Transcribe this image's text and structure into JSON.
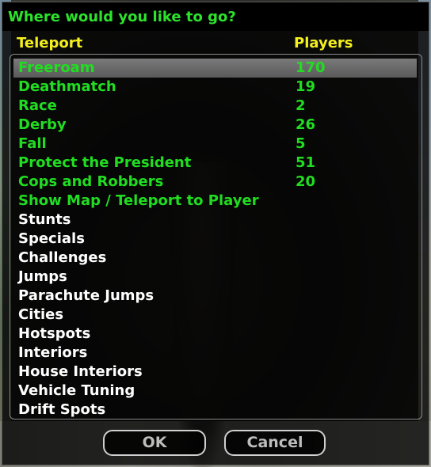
{
  "dialog": {
    "title": "Where would you like to go?",
    "headers": {
      "teleport": "Teleport",
      "players": "Players"
    },
    "rows": [
      {
        "name": "Freeroam",
        "players": "170",
        "color": "#21dd21",
        "selected": true
      },
      {
        "name": "Deathmatch",
        "players": "19",
        "color": "#21dd21",
        "selected": false
      },
      {
        "name": "Race",
        "players": "2",
        "color": "#21dd21",
        "selected": false
      },
      {
        "name": "Derby",
        "players": "26",
        "color": "#21dd21",
        "selected": false
      },
      {
        "name": "Fall",
        "players": "5",
        "color": "#21dd21",
        "selected": false
      },
      {
        "name": "Protect the President",
        "players": "51",
        "color": "#21dd21",
        "selected": false
      },
      {
        "name": "Cops and Robbers",
        "players": "20",
        "color": "#21dd21",
        "selected": false
      },
      {
        "name": "Show Map / Teleport to Player",
        "players": "",
        "color": "#21dd21",
        "selected": false
      },
      {
        "name": "Stunts",
        "players": "",
        "color": "#ffffff",
        "selected": false
      },
      {
        "name": "Specials",
        "players": "",
        "color": "#ffffff",
        "selected": false
      },
      {
        "name": "Challenges",
        "players": "",
        "color": "#ffffff",
        "selected": false
      },
      {
        "name": "Jumps",
        "players": "",
        "color": "#ffffff",
        "selected": false
      },
      {
        "name": "Parachute Jumps",
        "players": "",
        "color": "#ffffff",
        "selected": false
      },
      {
        "name": "Cities",
        "players": "",
        "color": "#ffffff",
        "selected": false
      },
      {
        "name": "Hotspots",
        "players": "",
        "color": "#ffffff",
        "selected": false
      },
      {
        "name": "Interiors",
        "players": "",
        "color": "#ffffff",
        "selected": false
      },
      {
        "name": "House Interiors",
        "players": "",
        "color": "#ffffff",
        "selected": false
      },
      {
        "name": "Vehicle Tuning",
        "players": "",
        "color": "#ffffff",
        "selected": false
      },
      {
        "name": "Drift Spots",
        "players": "",
        "color": "#ffffff",
        "selected": false
      }
    ],
    "buttons": {
      "ok": "OK",
      "cancel": "Cancel"
    }
  },
  "colors": {
    "title": "#2ce32c",
    "header": "#f4f01e",
    "highlight_row": "#21dd21",
    "normal_row": "#ffffff",
    "selection_bg": "#6a6a6a"
  }
}
